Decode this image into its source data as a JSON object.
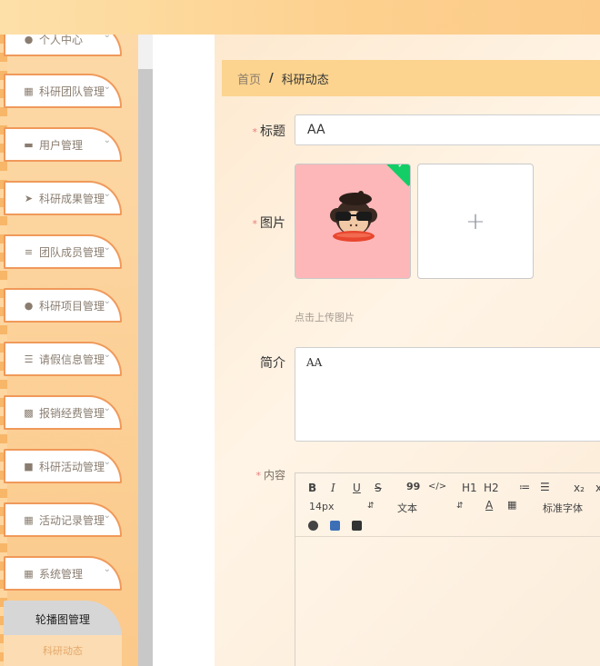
{
  "sidebar": {
    "items": [
      {
        "label": "个人中心",
        "icon": "user-icon"
      },
      {
        "label": "科研团队管理",
        "icon": "grid-icon"
      },
      {
        "label": "用户管理",
        "icon": "folder-icon"
      },
      {
        "label": "科研成果管理",
        "icon": "send-icon"
      },
      {
        "label": "团队成员管理",
        "icon": "list-icon"
      },
      {
        "label": "科研项目管理",
        "icon": "user-icon"
      },
      {
        "label": "请假信息管理",
        "icon": "filter-icon"
      },
      {
        "label": "报销经费管理",
        "icon": "card-icon"
      },
      {
        "label": "科研活动管理",
        "icon": "chat-icon"
      },
      {
        "label": "活动记录管理",
        "icon": "grid-icon"
      },
      {
        "label": "系统管理",
        "icon": "grid-icon"
      }
    ],
    "sub_active": "轮播图管理",
    "sub_next": "科研动态"
  },
  "breadcrumb": {
    "home": "首页",
    "separator": "/",
    "current": "科研动态"
  },
  "form": {
    "title_label": "标题",
    "title_value": "AA",
    "image_label": "图片",
    "upload_tip": "点击上传图片",
    "intro_label": "简介",
    "intro_value": "AA",
    "content_label": "内容",
    "required_mark": "*"
  },
  "editor": {
    "buttons": {
      "bold": "B",
      "italic": "I",
      "underline": "U",
      "strike": "S",
      "quote": "99",
      "code": "</>",
      "h1": "H1",
      "h2": "H2",
      "ordered_list": "≔",
      "bullet_list": "☰",
      "subscript": "x₂",
      "superscript": "x"
    },
    "font_size": "14px",
    "paragraph": "文本",
    "font_family": "标准字体",
    "text_color_glyph": "A"
  },
  "colors": {
    "accent": "#f0995a",
    "breadcrumb_bg": "#fcd48f",
    "check": "#13ce66",
    "thumb_bg": "#fdb7b9"
  }
}
